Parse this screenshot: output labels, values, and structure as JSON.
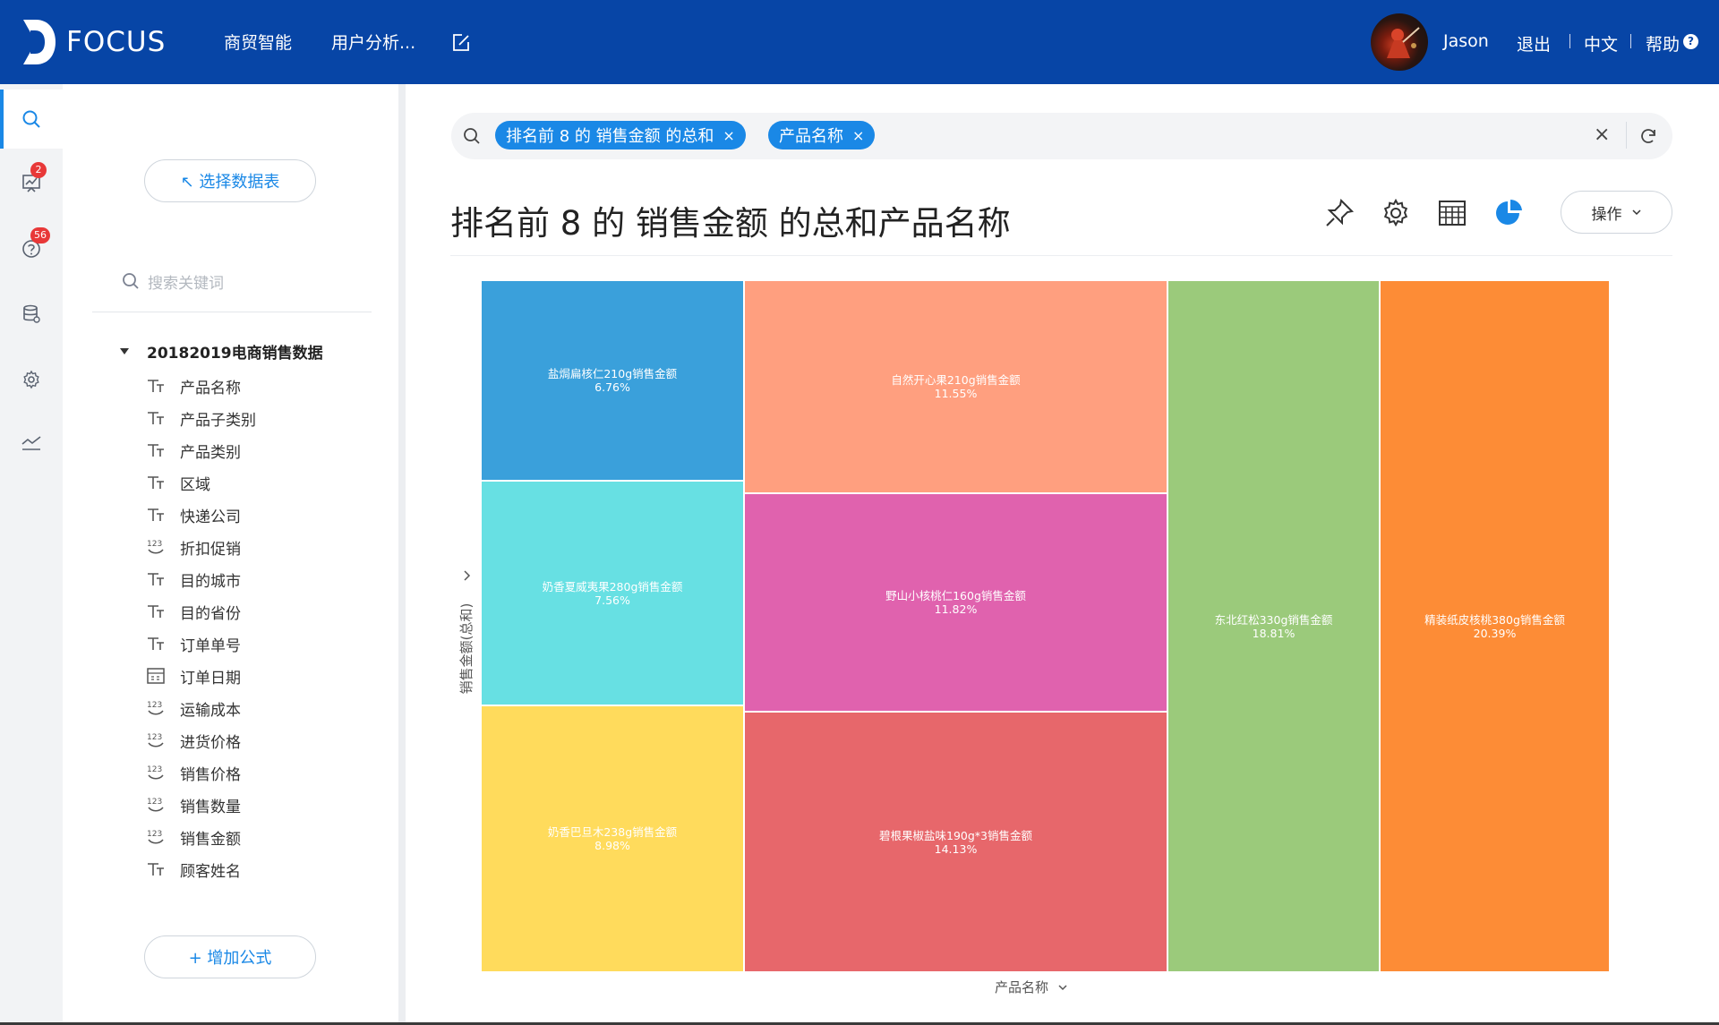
{
  "header": {
    "logo_text": "FOCUS",
    "nav": [
      "商贸智能",
      "用户分析..."
    ],
    "user_name": "Jason",
    "logout": "退出",
    "language": "中文",
    "help": "帮助",
    "help_mark": "?"
  },
  "iconbar": {
    "items": [
      {
        "icon": "search-icon",
        "active": true
      },
      {
        "icon": "chart-board-icon",
        "badge": "2"
      },
      {
        "icon": "question-icon",
        "badge": "56"
      },
      {
        "icon": "database-icon"
      },
      {
        "icon": "gear-icon"
      },
      {
        "icon": "trend-line-icon"
      }
    ]
  },
  "sidebar": {
    "select_table_button": "↖ 选择数据表",
    "search_placeholder": "搜索关键词",
    "dataset_name": "20182019电商销售数据",
    "fields": [
      {
        "label": "产品名称",
        "type": "text"
      },
      {
        "label": "产品子类别",
        "type": "text"
      },
      {
        "label": "产品类别",
        "type": "text"
      },
      {
        "label": "区域",
        "type": "text"
      },
      {
        "label": "快递公司",
        "type": "text"
      },
      {
        "label": "折扣促销",
        "type": "number"
      },
      {
        "label": "目的城市",
        "type": "text"
      },
      {
        "label": "目的省份",
        "type": "text"
      },
      {
        "label": "订单单号",
        "type": "text"
      },
      {
        "label": "订单日期",
        "type": "date"
      },
      {
        "label": "运输成本",
        "type": "number"
      },
      {
        "label": "进货价格",
        "type": "number"
      },
      {
        "label": "销售价格",
        "type": "number"
      },
      {
        "label": "销售数量",
        "type": "number"
      },
      {
        "label": "销售金额",
        "type": "number"
      },
      {
        "label": "顾客姓名",
        "type": "text"
      }
    ],
    "add_formula_button": "+ 增加公式"
  },
  "search": {
    "tokens": [
      "排名前 8 的 销售金额 的总和",
      "产品名称"
    ],
    "token_close": "×",
    "clear": "×"
  },
  "page_title": "排名前 8 的 销售金额 的总和产品名称",
  "toolbar": {
    "icons": [
      "pin-icon",
      "settings-gear-icon",
      "table-view-icon",
      "pie-chart-icon"
    ],
    "ops_label": "操作"
  },
  "chart_data": {
    "type": "treemap",
    "ylabel": "销售金额(总和)",
    "xlabel": "产品名称",
    "items": [
      {
        "label": "盐焗扁核仁210g销售金额",
        "pct": "6.76%",
        "value": 6.76,
        "color": "#3aa0db"
      },
      {
        "label": "奶香夏威夷果280g销售金额",
        "pct": "7.56%",
        "value": 7.56,
        "color": "#67e0e3"
      },
      {
        "label": "奶香巴旦木238g销售金额",
        "pct": "8.98%",
        "value": 8.98,
        "color": "#ffdb5c"
      },
      {
        "label": "自然开心果210g销售金额",
        "pct": "11.55%",
        "value": 11.55,
        "color": "#ff9f7f"
      },
      {
        "label": "野山小核桃仁160g销售金额",
        "pct": "11.82%",
        "value": 11.82,
        "color": "#e062ae"
      },
      {
        "label": "碧根果椒盐味190g*3销售金额",
        "pct": "14.13%",
        "value": 14.13,
        "color": "#e7676b"
      },
      {
        "label": "东北红松330g销售金额",
        "pct": "18.81%",
        "value": 18.81,
        "color": "#9bca7b"
      },
      {
        "label": "精装纸皮核桃380g销售金额",
        "pct": "20.39%",
        "value": 20.39,
        "color": "#fd8c36"
      }
    ]
  }
}
